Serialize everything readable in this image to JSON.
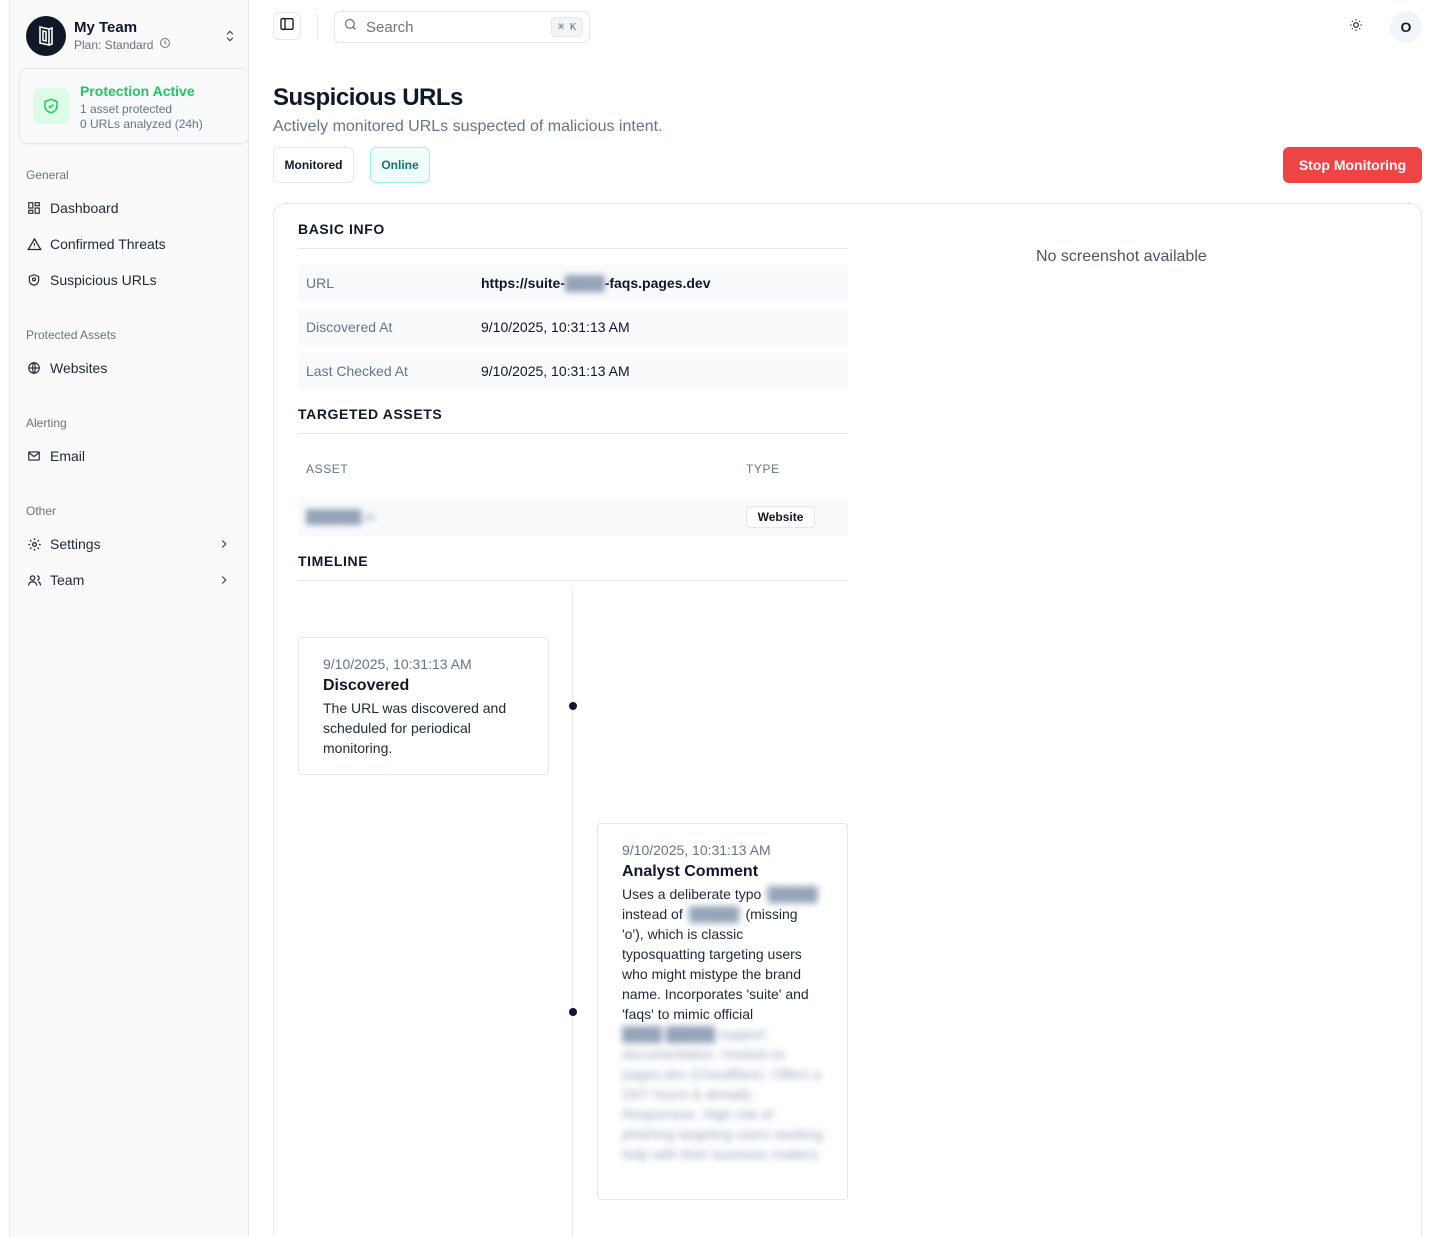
{
  "team": {
    "name": "My Team",
    "plan": "Plan: Standard"
  },
  "protection": {
    "title": "Protection Active",
    "assets": "1 asset protected",
    "urls": "0 URLs analyzed (24h)"
  },
  "nav": {
    "general_label": "General",
    "dashboard": "Dashboard",
    "confirmed_threats": "Confirmed Threats",
    "suspicious_urls": "Suspicious URLs",
    "protected_label": "Protected Assets",
    "websites": "Websites",
    "alerting_label": "Alerting",
    "email": "Email",
    "other_label": "Other",
    "settings": "Settings",
    "team": "Team"
  },
  "topbar": {
    "search_placeholder": "Search",
    "shortcut": "⌘ K",
    "avatar_initial": "O"
  },
  "page": {
    "title": "Suspicious URLs",
    "subtitle": "Actively monitored URLs suspected of malicious intent.",
    "badge_monitored": "Monitored",
    "badge_online": "Online",
    "stop_button": "Stop Monitoring"
  },
  "basic_info": {
    "title": "BASIC INFO",
    "url_label": "URL",
    "url_prefix": "https://suite-",
    "url_redacted": "████",
    "url_suffix": "-faqs.pages.dev",
    "discovered_label": "Discovered At",
    "discovered_value": "9/10/2025, 10:31:13 AM",
    "checked_label": "Last Checked At",
    "checked_value": "9/10/2025, 10:31:13 AM"
  },
  "targeted_assets": {
    "title": "TARGETED ASSETS",
    "col_asset": "ASSET",
    "col_type": "TYPE",
    "rows": [
      {
        "asset": "██████.io",
        "type": "Website"
      }
    ]
  },
  "screenshot": {
    "empty_text": "No screenshot available"
  },
  "timeline": {
    "title": "TIMELINE",
    "events": [
      {
        "date": "9/10/2025, 10:31:13 AM",
        "title": "Discovered",
        "body": "The URL was discovered and scheduled for periodical monitoring."
      },
      {
        "date": "9/10/2025, 10:31:13 AM",
        "title": "Analyst Comment",
        "body_1": "Uses a deliberate typo",
        "redacted_1": "'█████'",
        "body_2": "instead of",
        "redacted_2": "'█████'",
        "body_3": "(missing 'o'), which is classic typosquatting targeting users who might mistype the brand name. Incorporates 'suite' and 'faqs' to mimic official",
        "redacted_3": "████ █████ support documentation. Hosted on pages.dev (Cloudflare). Offers a 24/7 hours & already. Responsive. High risk of phishing targeting users seeking help with their business matters."
      }
    ]
  }
}
